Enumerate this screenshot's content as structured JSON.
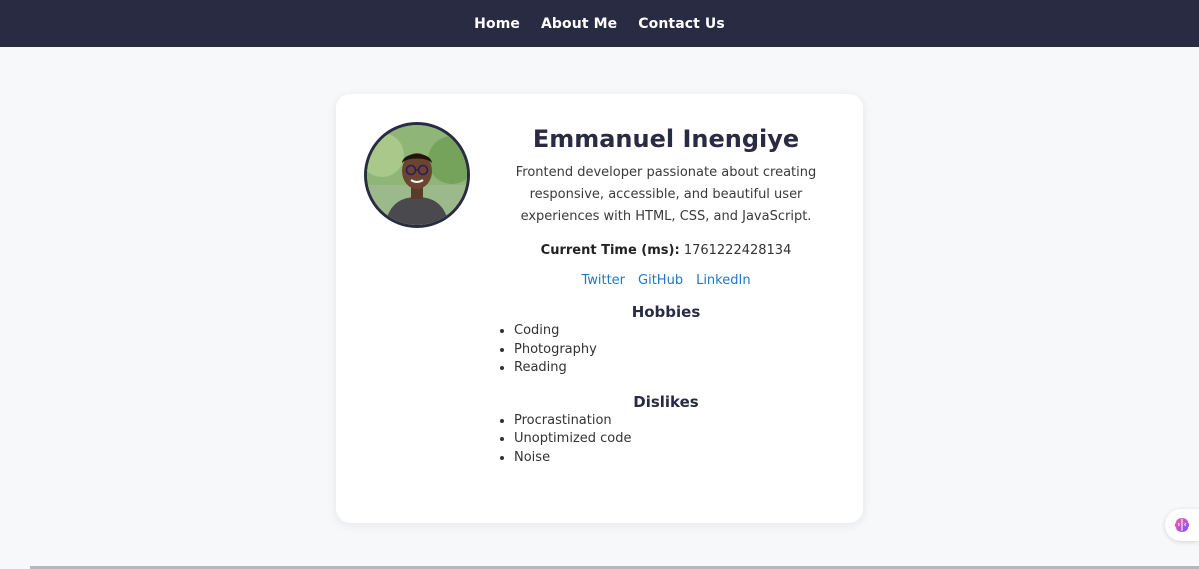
{
  "nav": {
    "items": [
      {
        "label": "Home"
      },
      {
        "label": "About Me"
      },
      {
        "label": "Contact Us"
      }
    ]
  },
  "profile": {
    "name": "Emmanuel Inengiye",
    "bio": "Frontend developer passionate about creating responsive, accessible, and beautiful user experiences with HTML, CSS, and JavaScript.",
    "time_label": "Current Time (ms):",
    "time_value": "1761222428134",
    "avatar_icon": "profile-photo",
    "socials": [
      {
        "label": "Twitter"
      },
      {
        "label": "GitHub"
      },
      {
        "label": "LinkedIn"
      }
    ]
  },
  "hobbies": {
    "title": "Hobbies",
    "items": [
      "Coding",
      "Photography",
      "Reading"
    ]
  },
  "dislikes": {
    "title": "Dislikes",
    "items": [
      "Procrastination",
      "Unoptimized code",
      "Noise"
    ]
  },
  "widget": {
    "icon": "brain-icon"
  },
  "colors": {
    "navbar": "#282b42",
    "link": "#1f78c8",
    "background": "#f7f8fa"
  }
}
